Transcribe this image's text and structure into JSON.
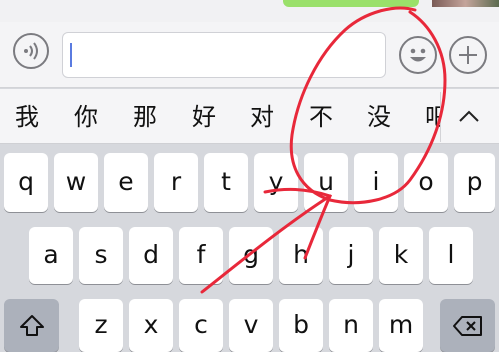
{
  "chat": {
    "bubble_color": "#9ae06a"
  },
  "input_bar": {
    "voice_button": "voice-icon",
    "text_value": "",
    "emoji_button": "smiley-icon",
    "plus_button": "plus-icon"
  },
  "candidates": {
    "items": [
      "我",
      "你",
      "那",
      "好",
      "对",
      "不",
      "没",
      "吧"
    ],
    "expand_icon": "chevron-up-icon"
  },
  "keyboard": {
    "row1": [
      "q",
      "w",
      "e",
      "r",
      "t",
      "y",
      "u",
      "i",
      "o",
      "p"
    ],
    "row2": [
      "a",
      "s",
      "d",
      "f",
      "g",
      "h",
      "j",
      "k",
      "l"
    ],
    "row3": [
      "z",
      "x",
      "c",
      "v",
      "b",
      "n",
      "m"
    ],
    "shift_icon": "shift-icon",
    "delete_icon": "backspace-icon"
  },
  "annotation": {
    "color": "#e8283a"
  }
}
